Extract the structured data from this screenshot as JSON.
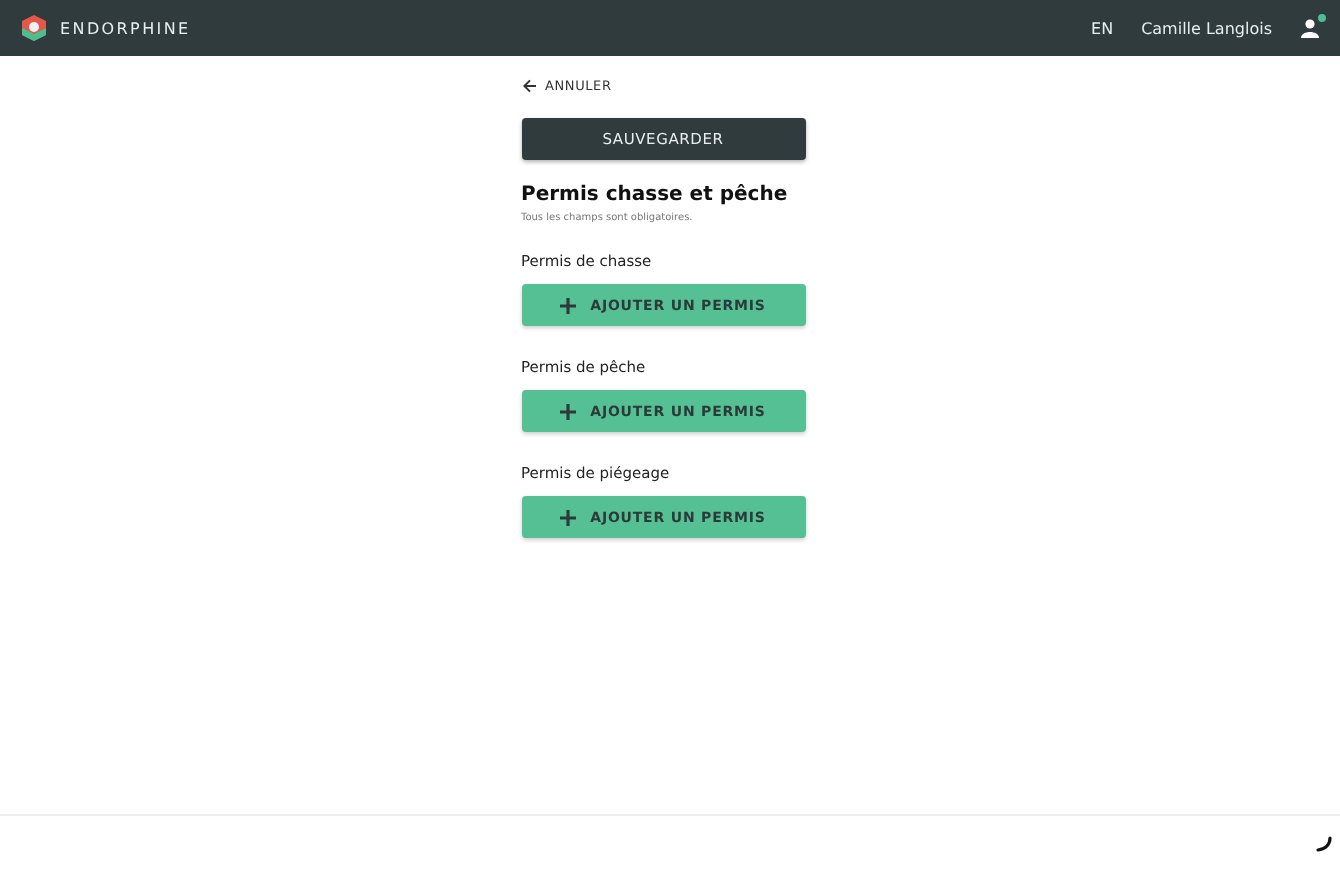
{
  "header": {
    "logo": "ENDORPHINE",
    "language": "EN",
    "user_name": "Camille Langlois",
    "user_online": true
  },
  "cancel_link": "ANNULER",
  "save_button": "SAUVEGARDER",
  "form": {
    "title": "Permis chasse et pêche",
    "subtitle": "Tous les champs sont obligatoires.",
    "sections": [
      {
        "label": "Permis de chasse",
        "button": "AJOUTER UN PERMIS"
      },
      {
        "label": "Permis de pêche",
        "button": "AJOUTER UN PERMIS"
      },
      {
        "label": "Permis de piégeage",
        "button": "AJOUTER UN PERMIS"
      }
    ]
  }
}
